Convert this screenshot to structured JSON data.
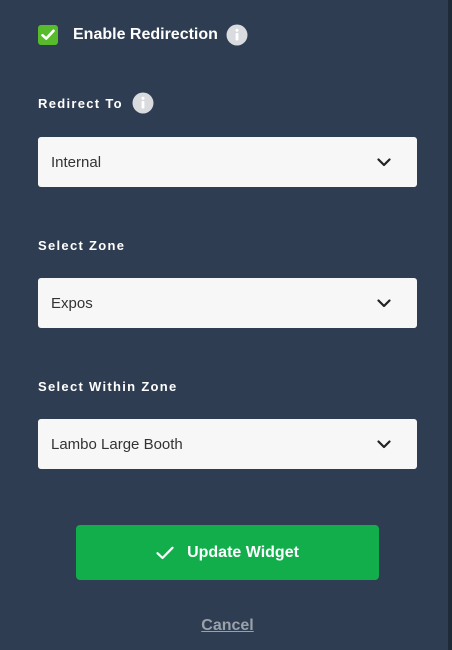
{
  "enable_redirection": {
    "checked": true,
    "label": "Enable Redirection"
  },
  "redirect_to": {
    "label": "Redirect To",
    "selected": "Internal"
  },
  "select_zone": {
    "label": "Select Zone",
    "selected": "Expos"
  },
  "select_within_zone": {
    "label": "Select Within Zone",
    "selected": "Lambo Large Booth"
  },
  "actions": {
    "update_label": "Update Widget",
    "cancel_label": "Cancel"
  },
  "colors": {
    "background": "#2e3d51",
    "checkbox": "#57bb2b",
    "primary_button": "#12ae4b",
    "select_background": "#f7f7f7",
    "cancel_text": "#9aa1aa"
  },
  "icons": {
    "checkbox": "check-icon",
    "info": "info-icon",
    "dropdown": "chevron-down-icon",
    "update": "check-icon"
  }
}
